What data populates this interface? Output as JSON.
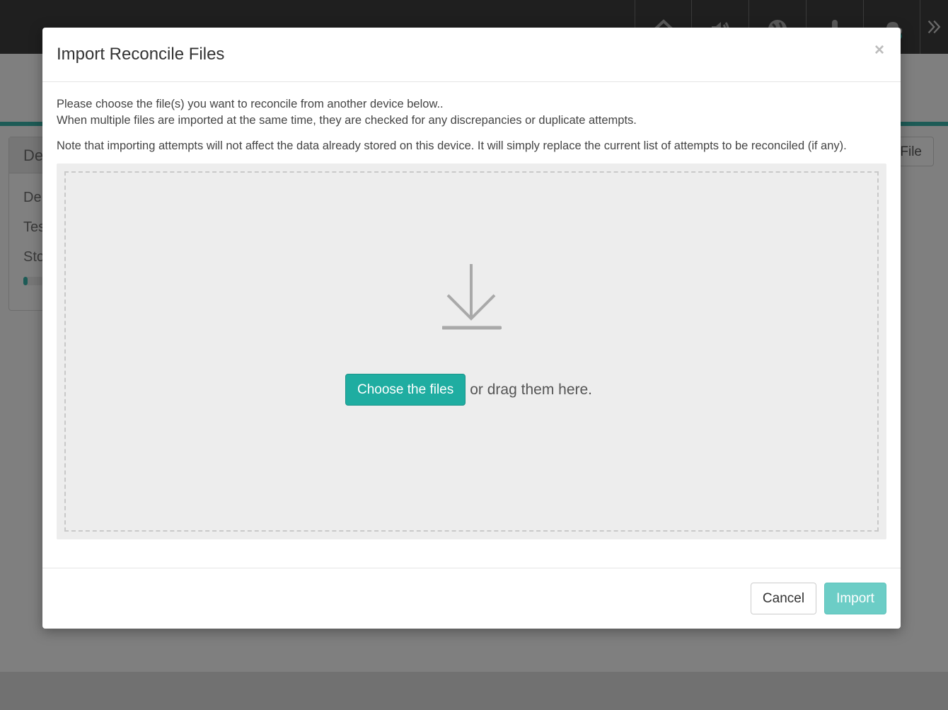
{
  "background": {
    "topbar_icons": [
      "home-icon",
      "volume-icon",
      "globe-icon",
      "microphone-icon",
      "cloud-icon",
      "double-chevron-right-icon"
    ],
    "panel_title_partial": "De",
    "panel_rows_partial": [
      "De",
      "Tes",
      "Sto"
    ],
    "file_button_partial": "File"
  },
  "modal": {
    "title": "Import Reconcile Files",
    "close_label": "×",
    "body": {
      "line1": "Please choose the file(s) you want to reconcile from another device below..",
      "line2": "When multiple files are imported at the same time, they are checked for any discrepancies or duplicate attempts.",
      "note": "Note that importing attempts will not affect the data already stored on this device. It will simply replace the current list of attempts to be reconciled (if any)."
    },
    "dropzone": {
      "icon": "download-icon",
      "choose_label": "Choose the files",
      "drag_text": "or drag them here."
    },
    "footer": {
      "cancel_label": "Cancel",
      "import_label": "Import"
    }
  },
  "colors": {
    "accent": "#1fada1",
    "accent_disabled": "#6ccdc6",
    "topbar": "#1f1f1f",
    "dropzone_bg": "#ededed"
  }
}
